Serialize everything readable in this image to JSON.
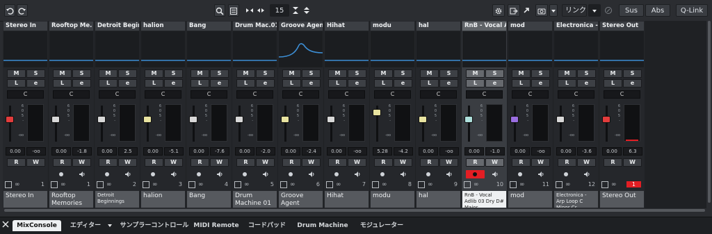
{
  "toolbar": {
    "undo_icon": "undo-icon",
    "redo_icon": "redo-icon",
    "channel_count": "15",
    "link_label": "リンク",
    "sus_label": "Sus",
    "abs_label": "Abs",
    "qlink_label": "Q-Link"
  },
  "channels": [
    {
      "header": "Stereo In",
      "vol": "0.00",
      "peak": "-oo",
      "num": "1",
      "name": "Stereo In",
      "fader_color": "#e23c3c",
      "fader_level": 0.36,
      "icon": "input-icon"
    },
    {
      "header": "Rooftop Me.",
      "vol": "0.00",
      "peak": "-1.8",
      "num": "1",
      "name": "Rooftop Memories",
      "fader_color": "#d8d8d8",
      "fader_level": 0.36,
      "icon": "audio-icon"
    },
    {
      "header": "Detroit Begin.",
      "vol": "0.00",
      "peak": "2.5",
      "num": "2",
      "name": "Detroit Beginnings",
      "fader_color": "#d8d8d8",
      "fader_level": 0.36,
      "icon": "audio-icon"
    },
    {
      "header": "halion",
      "vol": "0.00",
      "peak": "-5.1",
      "num": "3",
      "name": "halion",
      "fader_color": "#e8e3a0",
      "fader_level": 0.36,
      "icon": "instrument-icon"
    },
    {
      "header": "Bang",
      "vol": "0.00",
      "peak": "-7.6",
      "num": "4",
      "name": "Bang",
      "fader_color": "#d8d8d8",
      "fader_level": 0.36,
      "icon": "instrument-icon"
    },
    {
      "header": "Drum Mac.01",
      "vol": "0.00",
      "peak": "-2.0",
      "num": "5",
      "name": "Drum Machine 01",
      "fader_color": "#d8d8d8",
      "fader_level": 0.36,
      "icon": "instrument-icon"
    },
    {
      "header": "Groove Agent",
      "vol": "0.00",
      "peak": "-2.4",
      "num": "6",
      "name": "Groove Agent",
      "fader_color": "#e8e3a0",
      "fader_level": 0.36,
      "icon": "instrument-icon"
    },
    {
      "header": "Hihat",
      "vol": "0.00",
      "peak": "-oo",
      "num": "7",
      "name": "Hihat",
      "fader_color": "#d8d8d8",
      "fader_level": 0.36,
      "icon": "instrument-icon"
    },
    {
      "header": "modu",
      "vol": "5.28",
      "peak": "-4.2",
      "num": "8",
      "name": "modu",
      "fader_color": "#e8e3a0",
      "fader_level": 0.12,
      "icon": "instrument-icon"
    },
    {
      "header": "hal",
      "vol": "0.00",
      "peak": "-oo",
      "num": "9",
      "name": "hal",
      "fader_color": "#e8e3a0",
      "fader_level": 0.36,
      "icon": "instrument-icon"
    },
    {
      "header": "RnB - Vocal A.",
      "vol": "0.00",
      "peak": "-1.0",
      "num": "10",
      "name": "RnB - Vocal Adlib 03 Dry D# Major",
      "fader_color": "#aee0dc",
      "fader_level": 0.36,
      "icon": "sampler-icon"
    },
    {
      "header": "mod",
      "vol": "0.00",
      "peak": "-oo",
      "num": "11",
      "name": "mod",
      "fader_color": "#9a6ee0",
      "fader_level": 0.36,
      "icon": "fx-icon"
    },
    {
      "header": "Electronica - .",
      "vol": "0.00",
      "peak": "-3.6",
      "num": "12",
      "name": "Electronica - Arp Loop C Minor Cr",
      "fader_color": "#d8d8d8",
      "fader_level": 0.36,
      "icon": "sampler-icon"
    },
    {
      "header": "Stereo Out",
      "vol": "0.00",
      "peak": "6.3",
      "num": "1",
      "name": "Stereo Out",
      "fader_color": "#e23c3c",
      "fader_level": 0.36,
      "icon": "output-icon"
    }
  ],
  "strip_buttons": {
    "mute": "M",
    "solo": "S",
    "listen": "L",
    "edit": "e",
    "read": "R",
    "write": "W",
    "pan": "C"
  },
  "scale_labels": [
    "6",
    "0",
    "5",
    "-",
    "-oo"
  ],
  "tabs": [
    {
      "label": "MixConsole",
      "active": true
    },
    {
      "label": "エディター",
      "active": false
    },
    {
      "label": "サンプラーコントロール",
      "active": false
    },
    {
      "label": "MIDI Remote",
      "active": false
    },
    {
      "label": "コードパッド",
      "active": false
    },
    {
      "label": "Drum Machine",
      "active": false
    },
    {
      "label": "モジュレーター",
      "active": false
    }
  ],
  "colors": {
    "accent_blue": "#3d8fd6",
    "record_red": "#e31e24",
    "selected_strip": "#3a3d42"
  }
}
